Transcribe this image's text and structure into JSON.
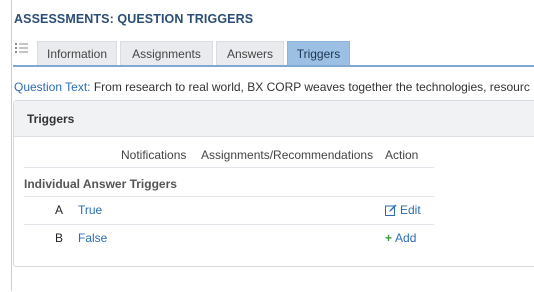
{
  "page_title": "ASSESSMENTS: QUESTION TRIGGERS",
  "tabs": [
    {
      "label": "Information",
      "active": false
    },
    {
      "label": "Assignments",
      "active": false
    },
    {
      "label": "Answers",
      "active": false
    },
    {
      "label": "Triggers",
      "active": true
    }
  ],
  "question": {
    "label": "Question Text:",
    "text": "From research to real world, BX CORP weaves together the technologies, resourc"
  },
  "panel": {
    "title": "Triggers",
    "columns": [
      "Notifications",
      "Assignments/Recommendations",
      "Action"
    ],
    "group_label": "Individual Answer Triggers",
    "rows": [
      {
        "letter": "A",
        "answer": "True",
        "action": "Edit"
      },
      {
        "letter": "B",
        "answer": "False",
        "action": "Add"
      }
    ]
  },
  "colors": {
    "title": "#2b4e77",
    "link": "#2a6db5",
    "active_tab": "#9cc0e3",
    "tab_underline": "#7fa9d4",
    "add_plus": "#3c9a3c"
  },
  "icons": {
    "menu": "list-icon",
    "edit": "edit-icon",
    "add": "plus-icon"
  }
}
